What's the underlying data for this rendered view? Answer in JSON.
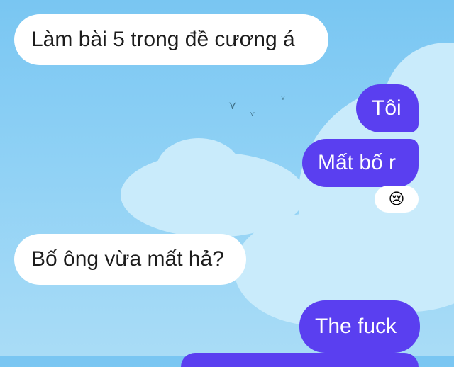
{
  "messages": [
    {
      "id": "msg1",
      "side": "incoming",
      "text": "Làm bài 5 trong đề cương á"
    },
    {
      "id": "msg2",
      "side": "outgoing",
      "text": "Tôi"
    },
    {
      "id": "msg3",
      "side": "outgoing",
      "text": "Mất bố r"
    },
    {
      "id": "msg4",
      "side": "incoming",
      "text": "Bố ông vừa mất hả?"
    },
    {
      "id": "msg5",
      "side": "outgoing",
      "text": "The fuck"
    }
  ],
  "reaction": {
    "emoji": "😢",
    "icon": "crying-face-icon"
  },
  "colors": {
    "outgoing_bubble": "#5a3ff0",
    "incoming_bubble": "#ffffff",
    "background_sky": "#8fd1f5"
  }
}
